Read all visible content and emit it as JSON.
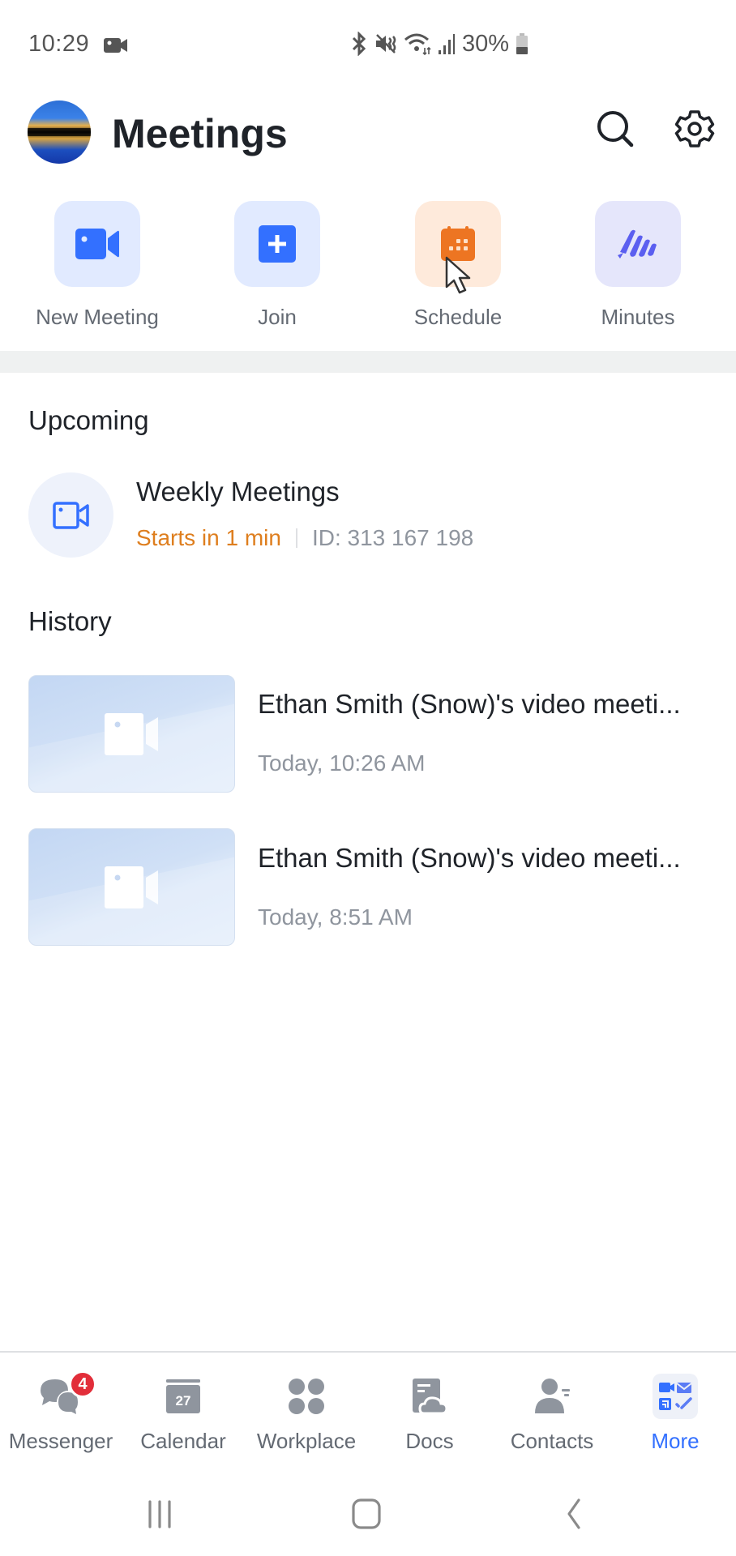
{
  "status_bar": {
    "time": "10:29",
    "battery": "30%",
    "icons": [
      "video-record-icon",
      "bluetooth-icon",
      "mute-icon",
      "wifi-icon",
      "signal-icon",
      "battery-icon"
    ]
  },
  "header": {
    "title": "Meetings",
    "icons": [
      "search-icon",
      "gear-icon"
    ]
  },
  "quick_actions": [
    {
      "label": "New Meeting",
      "icon": "video-camera-icon",
      "color": "#3370ff"
    },
    {
      "label": "Join",
      "icon": "plus-icon",
      "color": "#3370ff"
    },
    {
      "label": "Schedule",
      "icon": "calendar-icon",
      "color": "#ed7522"
    },
    {
      "label": "Minutes",
      "icon": "minutes-pen-icon",
      "color": "#5b5ff0"
    }
  ],
  "upcoming": {
    "title": "Upcoming",
    "items": [
      {
        "name": "Weekly Meetings",
        "status": "Starts in 1 min",
        "meeting_id": "ID: 313 167 198"
      }
    ]
  },
  "history": {
    "title": "History",
    "items": [
      {
        "title": "Ethan Smith (Snow)'s video meeti...",
        "date": "Today, 10:26 AM"
      },
      {
        "title": "Ethan Smith (Snow)'s video meeti...",
        "date": "Today, 8:51 AM"
      }
    ]
  },
  "tabbar": {
    "items": [
      {
        "label": "Messenger",
        "badge": "4",
        "active": false
      },
      {
        "label": "Calendar",
        "day": "27",
        "active": false
      },
      {
        "label": "Workplace",
        "active": false
      },
      {
        "label": "Docs",
        "active": false
      },
      {
        "label": "Contacts",
        "active": false
      },
      {
        "label": "More",
        "active": true
      }
    ],
    "active_color": "#3370ff"
  },
  "colors": {
    "accent": "#3370ff",
    "warning": "#de7e1e",
    "text_primary": "#1f2329",
    "text_secondary": "#8f959e"
  }
}
